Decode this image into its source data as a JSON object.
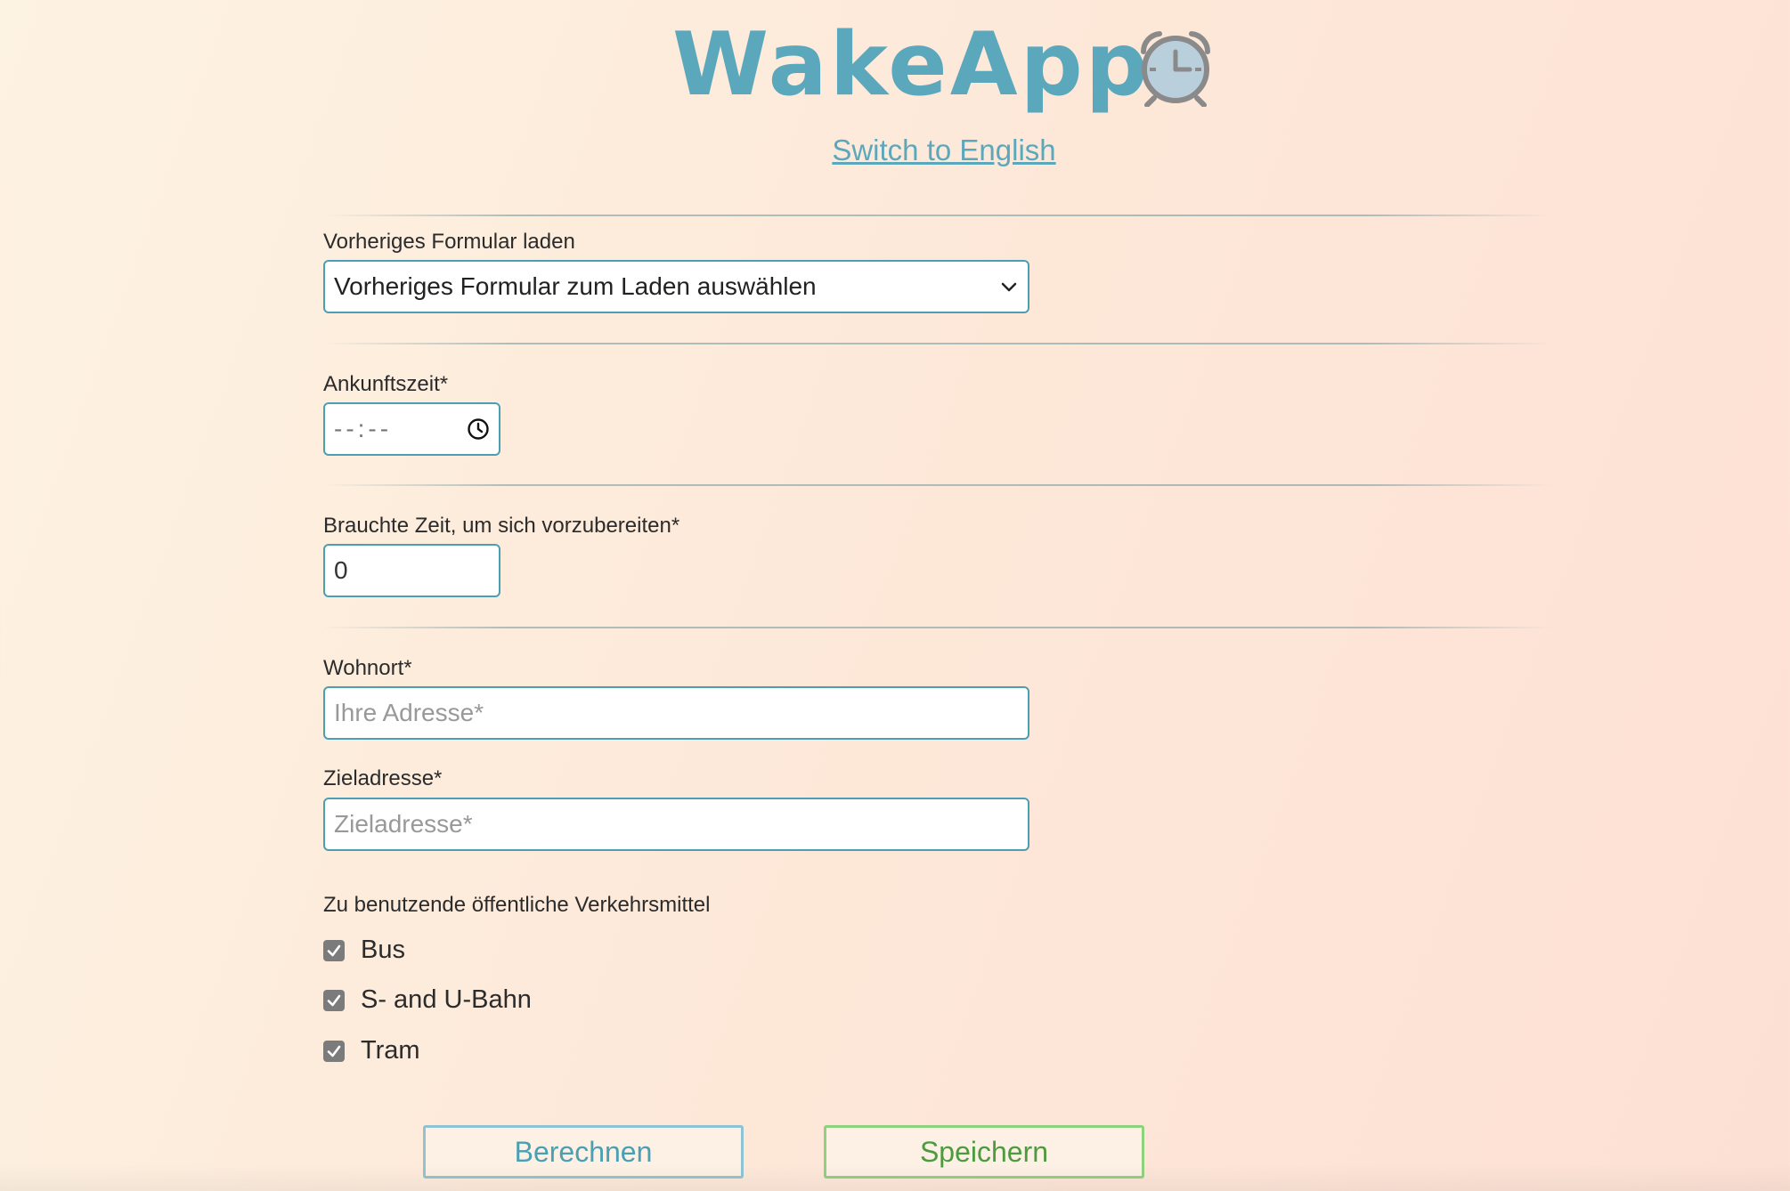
{
  "app": {
    "title": "WakeApp",
    "language_link": "Switch to English"
  },
  "form": {
    "previous": {
      "label": "Vorheriges Formular laden",
      "selected": "Vorheriges Formular zum Laden auswählen"
    },
    "arrival": {
      "label": "Ankunftszeit*",
      "placeholder": "--:--"
    },
    "prep": {
      "label": "Brauchte Zeit, um sich vorzubereiten*",
      "value": "0"
    },
    "home": {
      "label": "Wohnort*",
      "placeholder": "Ihre Adresse*"
    },
    "destination": {
      "label": "Zieladresse*",
      "placeholder": "Zieladresse*"
    },
    "transport": {
      "label": "Zu benutzende öffentliche Verkehrsmittel",
      "options": [
        {
          "label": "Bus",
          "checked": true
        },
        {
          "label": "S- and U-Bahn",
          "checked": true
        },
        {
          "label": "Tram",
          "checked": true
        }
      ]
    }
  },
  "actions": {
    "calculate": "Berechnen",
    "save": "Speichern"
  },
  "colors": {
    "accent": "#5ba8bd",
    "save": "#4e9a3f",
    "checkbox": "#7b7b7b"
  },
  "icons": {
    "title": "alarm-clock-icon",
    "time": "clock-icon",
    "select": "chevron-down-icon",
    "check": "checkmark-icon"
  }
}
